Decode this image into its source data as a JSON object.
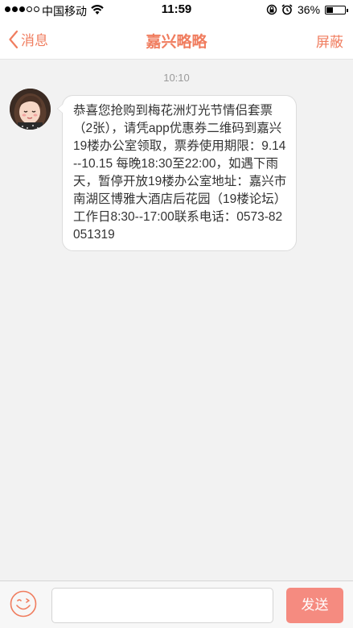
{
  "status_bar": {
    "carrier": "中国移动",
    "time": "11:59",
    "battery_percent": "36%",
    "battery_level": 0.36,
    "signal_bars_filled": 3,
    "signal_bars_total": 5
  },
  "nav": {
    "back_label": "消息",
    "title": "嘉兴略略",
    "block_label": "屏蔽"
  },
  "chat": {
    "timestamp": "10:10",
    "messages": [
      {
        "sender": "received",
        "text": "恭喜您抢购到梅花洲灯光节情侣套票（2张），请凭app优惠券二维码到嘉兴19楼办公室领取，票券使用期限：9.14--10.15 每晚18:30至22:00，如遇下雨天，暂停开放19楼办公室地址：嘉兴市南湖区博雅大酒店后花园（19楼论坛）工作日8:30--17:00联系电话：0573-82051319"
      }
    ]
  },
  "composer": {
    "input_value": "",
    "send_label": "发送"
  },
  "colors": {
    "accent": "#f07d5f",
    "send_button": "#f58b80",
    "background": "#f2f2f2"
  },
  "icons": {
    "back": "chevron-left-icon",
    "emoji": "emoji-icon",
    "wifi": "wifi-icon",
    "lock": "rotation-lock-icon",
    "alarm": "alarm-icon"
  }
}
